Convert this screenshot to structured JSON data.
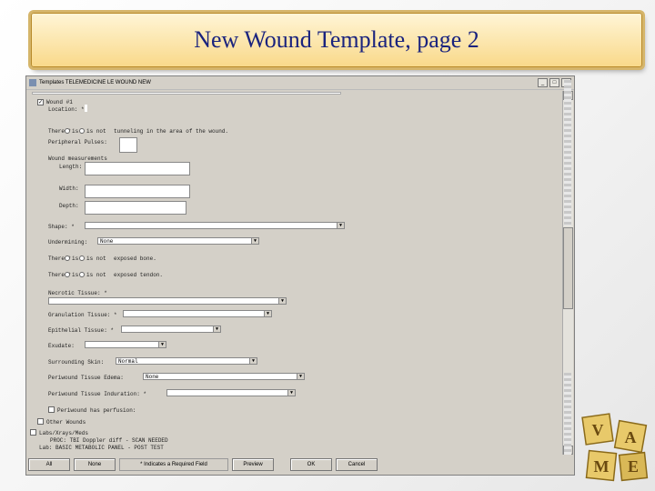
{
  "slide": {
    "title": "New Wound Template, page 2"
  },
  "window": {
    "title": "Templates TELEMEDICINE LE WOUND NEW",
    "min": "_",
    "max": "□",
    "close": "×"
  },
  "form": {
    "wound_label": "Wound #1",
    "location_label": "Location: *",
    "there_label": "There *",
    "is": "is",
    "is_not_opt": "is not",
    "tunneling_tail": "tunneling in the area of the wound.",
    "peripheral_label": "Peripheral Pulses:",
    "measurements_label": "Wound measurements",
    "length_label": "Length:",
    "width_label": "Width:",
    "depth_label": "Depth:",
    "shape_label": "Shape: *",
    "undermining_label": "Undermining:",
    "undermining_value": "None",
    "bone_label": "There *",
    "bone_tail": "exposed bone.",
    "tendon_label": "There *",
    "tendon_tail": "exposed tendon.",
    "necrotic_label": "Necrotic Tissue: *",
    "granulation_label": "Granulation Tissue: *",
    "epithelial_label": "Epithelial Tissue: *",
    "exudate_label": "Exudate:",
    "surrounding_label": "Surrounding Skin:",
    "surrounding_value": "Normal",
    "periwound_edema_label": "Periwound Tissue Edema:",
    "periwound_edema_value": "None",
    "periwound_induration_label": "Periwound Tissue Induration: *",
    "perfusion_label": "Periwound has perfusion:",
    "other_wounds_label": "Other Wounds",
    "labs_label": "Labs/Xrays/Meds",
    "lab_line1": "PROC: TBI Doppler diff - SCAN NEEDED",
    "lab_line2": "Lab: BASIC METABOLIC PANEL - POST TEST"
  },
  "footer": {
    "all": "All",
    "none": "None",
    "status": "* Indicates a Required Field",
    "preview": "Preview",
    "ok": "OK",
    "cancel": "Cancel"
  },
  "logo": {
    "letters": [
      "V",
      "A",
      "M",
      "E"
    ]
  }
}
